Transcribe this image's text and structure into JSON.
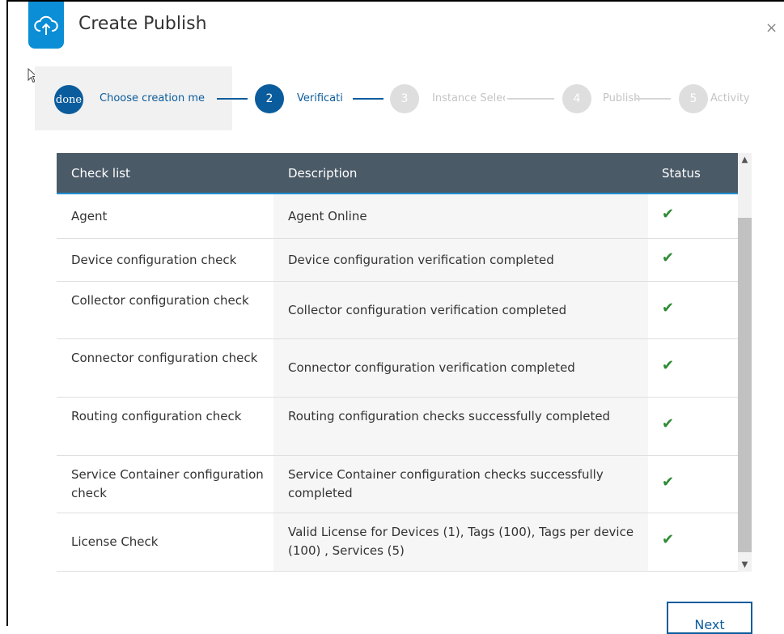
{
  "dialog": {
    "title": "Create Publish",
    "close_label": "×",
    "logo_icon": "cloud-upload-icon"
  },
  "colors": {
    "accent": "#0b8ed6",
    "step_active": "#0b5c9c",
    "step_inactive": "#dedede",
    "header_bg": "#4b5a67",
    "check_green": "#2e8b34"
  },
  "stepper": {
    "steps": [
      {
        "marker": "done",
        "label": "Choose creation me",
        "state": "done"
      },
      {
        "marker": "2",
        "label": "Verificati",
        "state": "active"
      },
      {
        "marker": "3",
        "label": "Instance Selec",
        "state": "inactive"
      },
      {
        "marker": "4",
        "label": "Publish",
        "state": "inactive"
      },
      {
        "marker": "5",
        "label": "Activity",
        "state": "inactive"
      }
    ]
  },
  "table": {
    "headers": {
      "check": "Check list",
      "description": "Description",
      "status": "Status"
    },
    "rows": [
      {
        "check": "Agent",
        "description": "Agent Online",
        "status": "✔"
      },
      {
        "check": "Device configuration check",
        "description": "Device configuration verification completed",
        "status": "✔"
      },
      {
        "check": "Collector configuration check",
        "description": "Collector configuration verification completed",
        "status": "✔"
      },
      {
        "check": "Connector configuration check",
        "description": "Connector configuration verification completed",
        "status": "✔"
      },
      {
        "check": "Routing configuration check",
        "description": "Routing configuration checks successfully completed",
        "status": "✔"
      },
      {
        "check": "Service Container configuration check",
        "description": "Service Container configuration checks successfully completed",
        "status": "✔"
      },
      {
        "check": "License Check",
        "description": "Valid License for Devices (1), Tags (100), Tags per device (100) , Services (5)",
        "status": "✔"
      }
    ]
  },
  "footer": {
    "next_label": "Next"
  }
}
